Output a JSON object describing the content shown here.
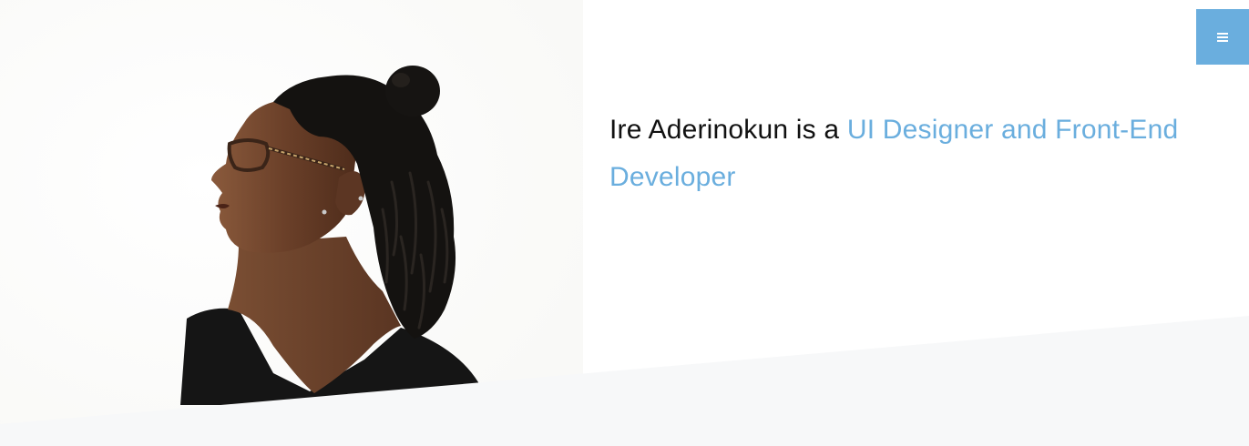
{
  "hero": {
    "intro_prefix": "Ire Aderinokun is a ",
    "intro_role": "UI Designer and Front-End Developer",
    "photo_alt": "Ire Aderinokun"
  },
  "header": {
    "menu_icon": "hamburger-menu-icon"
  },
  "colors": {
    "accent": "#6aaede",
    "text": "#111111",
    "band": "#f7f8f9",
    "background": "#ffffff"
  }
}
